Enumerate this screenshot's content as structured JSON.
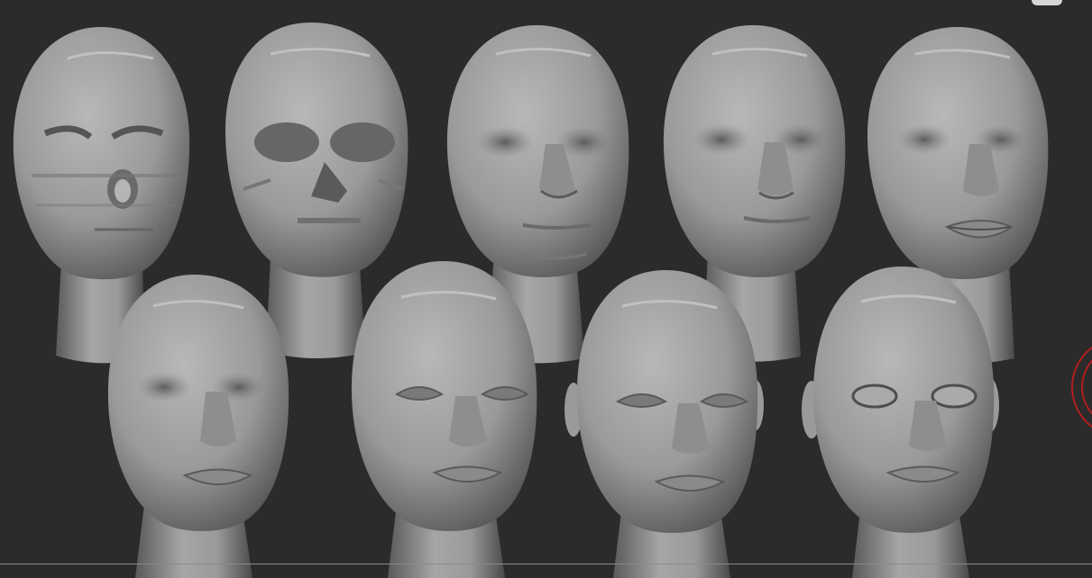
{
  "viewport": {
    "background_color": "#2b2b2b",
    "content": "sculpt-progression",
    "head_count": 9,
    "material_color": "#9c9c9c",
    "gizmo_color": "#b01e1e"
  },
  "heads": [
    {
      "stage": 1,
      "detail": "blockout"
    },
    {
      "stage": 2,
      "detail": "skull-planes"
    },
    {
      "stage": 3,
      "detail": "basic-nose"
    },
    {
      "stage": 4,
      "detail": "refined-nose"
    },
    {
      "stage": 5,
      "detail": "lips-added"
    },
    {
      "stage": 6,
      "detail": "cheek-refinement"
    },
    {
      "stage": 7,
      "detail": "eyelids-blocked"
    },
    {
      "stage": 8,
      "detail": "ears-added"
    },
    {
      "stage": 9,
      "detail": "eyeballs-final"
    }
  ]
}
